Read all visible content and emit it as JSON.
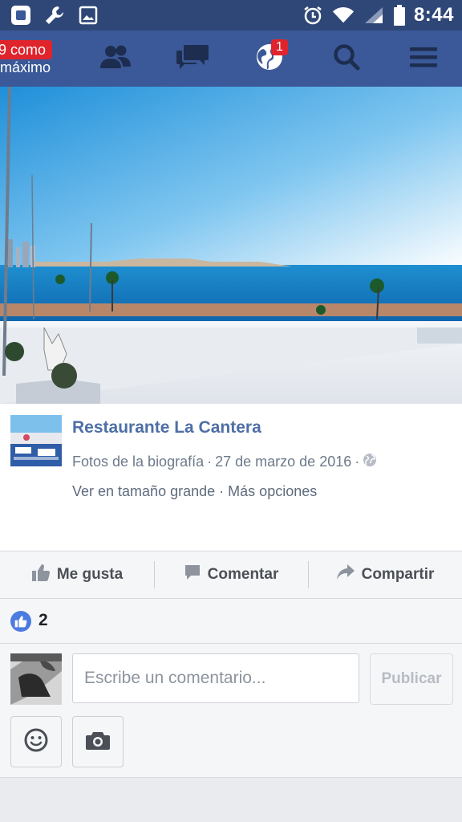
{
  "status_bar": {
    "time": "8:44",
    "icons": [
      "app-icon",
      "wrench-icon",
      "image-icon",
      "alarm-icon",
      "wifi-icon",
      "signal-icon",
      "battery-icon"
    ]
  },
  "nav": {
    "overlay_badge": "9 como",
    "overlay_sub": "máximo",
    "notification_count": "1",
    "icons": [
      "friends-icon",
      "messages-icon",
      "globe-icon",
      "search-icon",
      "menu-icon"
    ]
  },
  "post": {
    "page_name": "Restaurante La Cantera",
    "album": "Fotos de la biografía",
    "separator": "·",
    "date": "27 de marzo de 2016",
    "view_large": "Ver en tamaño grande",
    "more_options": "Más opciones"
  },
  "actions": {
    "like": "Me gusta",
    "comment": "Comentar",
    "share": "Compartir"
  },
  "reactions": {
    "like_count": "2"
  },
  "composer": {
    "placeholder": "Escribe un comentario...",
    "publish": "Publicar"
  },
  "colors": {
    "brand": "#3b5998",
    "status_bar": "#2f4777",
    "badge": "#e0242c"
  }
}
